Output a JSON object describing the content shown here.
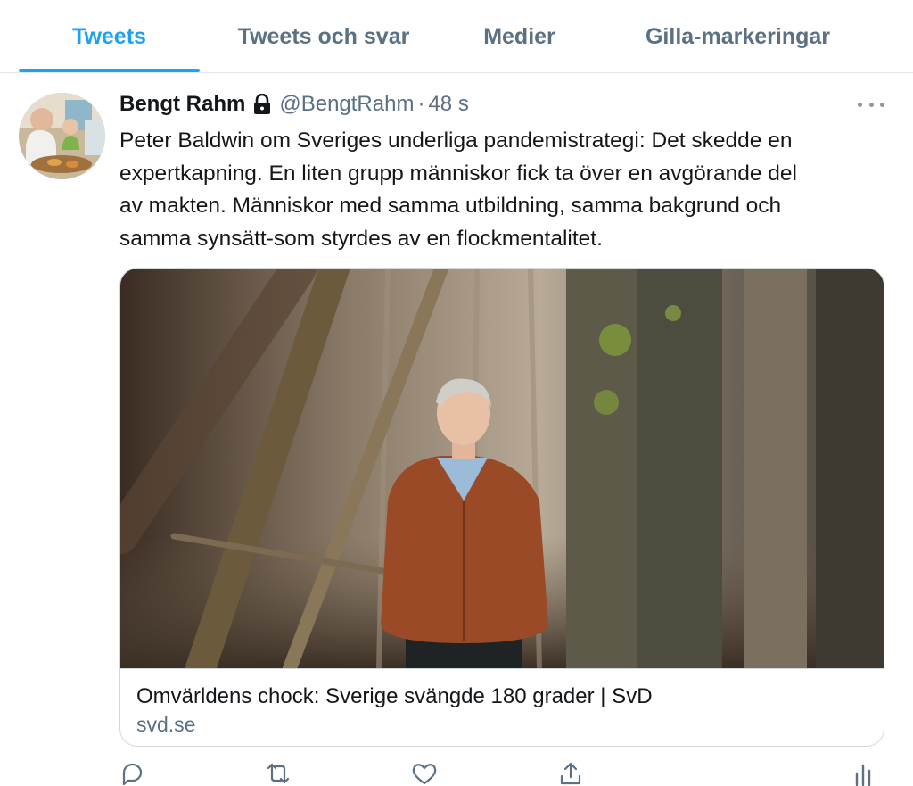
{
  "tabs": [
    {
      "label": "Tweets",
      "active": true
    },
    {
      "label": "Tweets och svar",
      "active": false
    },
    {
      "label": "Medier",
      "active": false
    },
    {
      "label": "Gilla-markeringar",
      "active": false
    }
  ],
  "tweet": {
    "author_name": "Bengt Rahm",
    "protected_icon": "lock-icon",
    "handle": "@BengtRahm",
    "separator": "·",
    "time": "48 s",
    "text_lines": [
      "Peter Baldwin om Sveriges underliga pandemistrategi: Det skedde en",
      "expertkapning. En liten grupp människor fick ta över en avgörande del",
      "av makten. Människor med samma utbildning, samma bakgrund och",
      "samma synsätt-som styrdes av en flockmentalitet."
    ],
    "card": {
      "title": "Omvärldens chock: Sverige svängde 180 grader | SvD",
      "domain": "svd.se"
    }
  },
  "actions": [
    "reply-icon",
    "retweet-icon",
    "like-icon",
    "share-icon",
    "analytics-icon"
  ],
  "colors": {
    "accent": "#1da1f2",
    "secondary_text": "#5b7083",
    "border": "#e1e8ed"
  }
}
